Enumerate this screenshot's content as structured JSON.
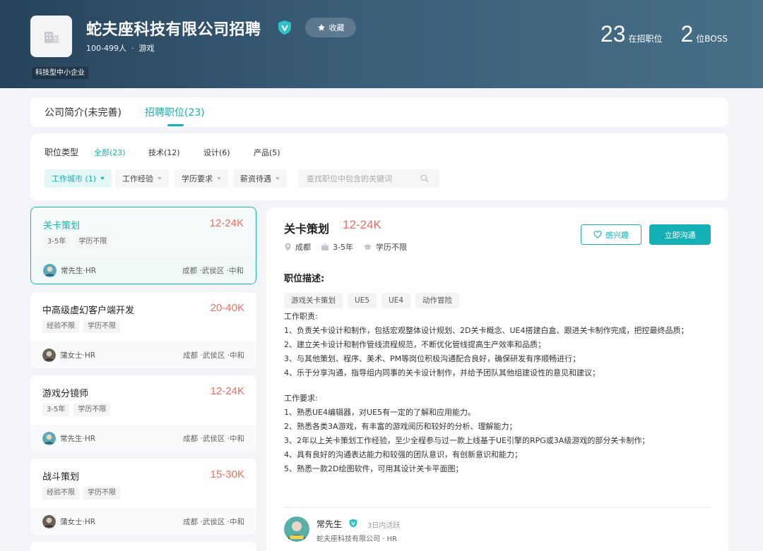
{
  "company": {
    "name": "蛇夫座科技有限公司招聘",
    "favorite_label": "收藏",
    "size": "100-499人",
    "industry": "游戏",
    "tag": "科技型中小企业",
    "stats": [
      {
        "num": "23",
        "label": "在招职位"
      },
      {
        "num": "2",
        "label": "位BOSS"
      }
    ]
  },
  "tabs": [
    "公司简介(未完善)",
    "招聘职位(23)"
  ],
  "filters": {
    "label": "职位类型",
    "categories": [
      "全部(23)",
      "技术(12)",
      "设计(6)",
      "产品(5)"
    ],
    "dropdowns": [
      "工作城市 (1)",
      "工作经验",
      "学历要求",
      "薪资待遇"
    ],
    "search_placeholder": "查找职位中包含的关键词"
  },
  "jobs": [
    {
      "title": "关卡策划",
      "salary": "12-24K",
      "chips": [
        "3-5年",
        "学历不限"
      ],
      "hr": "常先生·HR",
      "location": "成都 ·武侯区 ·中和"
    },
    {
      "title": "中高级虚幻客户端开发",
      "salary": "20-40K",
      "chips": [
        "经验不限",
        "学历不限"
      ],
      "hr": "蒲女士·HR",
      "location": "成都 ·武侯区 ·中和"
    },
    {
      "title": "游戏分镜师",
      "salary": "12-24K",
      "chips": [
        "3-5年",
        "学历不限"
      ],
      "hr": "常先生·HR",
      "location": "成都 ·武侯区 ·中和"
    },
    {
      "title": "战斗策划",
      "salary": "15-30K",
      "chips": [
        "经验不限",
        "学历不限"
      ],
      "hr": "蒲女士·HR",
      "location": "成都 ·武侯区 ·中和"
    }
  ],
  "detail": {
    "title": "关卡策划",
    "salary": "12-24K",
    "city": "成都",
    "experience": "3-5年",
    "education": "学历不限",
    "interest_label": "感兴趣",
    "chat_label": "立即沟通",
    "desc_heading": "职位描述:",
    "tags": [
      "游戏关卡策划",
      "UE5",
      "UE4",
      "动作冒险"
    ],
    "duties_heading": "工作职责:",
    "duties": [
      "1、负责关卡设计和制作，包括宏观整体设计规划、2D关卡概念、UE4搭建白盒、跟进关卡制作完成，把控最终品质；",
      "2、建立关卡设计和制作管线流程规范，不断优化管线提高生产效率和品质；",
      "3、与其他策划、程序、美术、PM等岗位积极沟通配合良好，确保研发有序顺畅进行；",
      "4、乐于分享沟通，指导组内同事的关卡设计制作，并给予团队其他组建设性的意见和建议；"
    ],
    "req_heading": "工作要求:",
    "requirements": [
      "1、熟悉UE4编辑器，对UE5有一定的了解和应用能力。",
      "2、熟悉各类3A游戏，有丰富的游戏阅历和较好的分析、理解能力；",
      "3、2年以上关卡策划工作经验，至少全程参与过一款上线基于UE引擎的RPG或3A级游戏的部分关卡制作；",
      "4、具有良好的沟通表达能力和较强的团队意识，有创新意识和能力；",
      "5、熟悉一款2D绘图软件，可用其设计关卡平面图；"
    ],
    "recruiter": {
      "name": "常先生",
      "active": "3日内活跃",
      "company": "蛇夫座科技有限公司 · HR"
    }
  }
}
